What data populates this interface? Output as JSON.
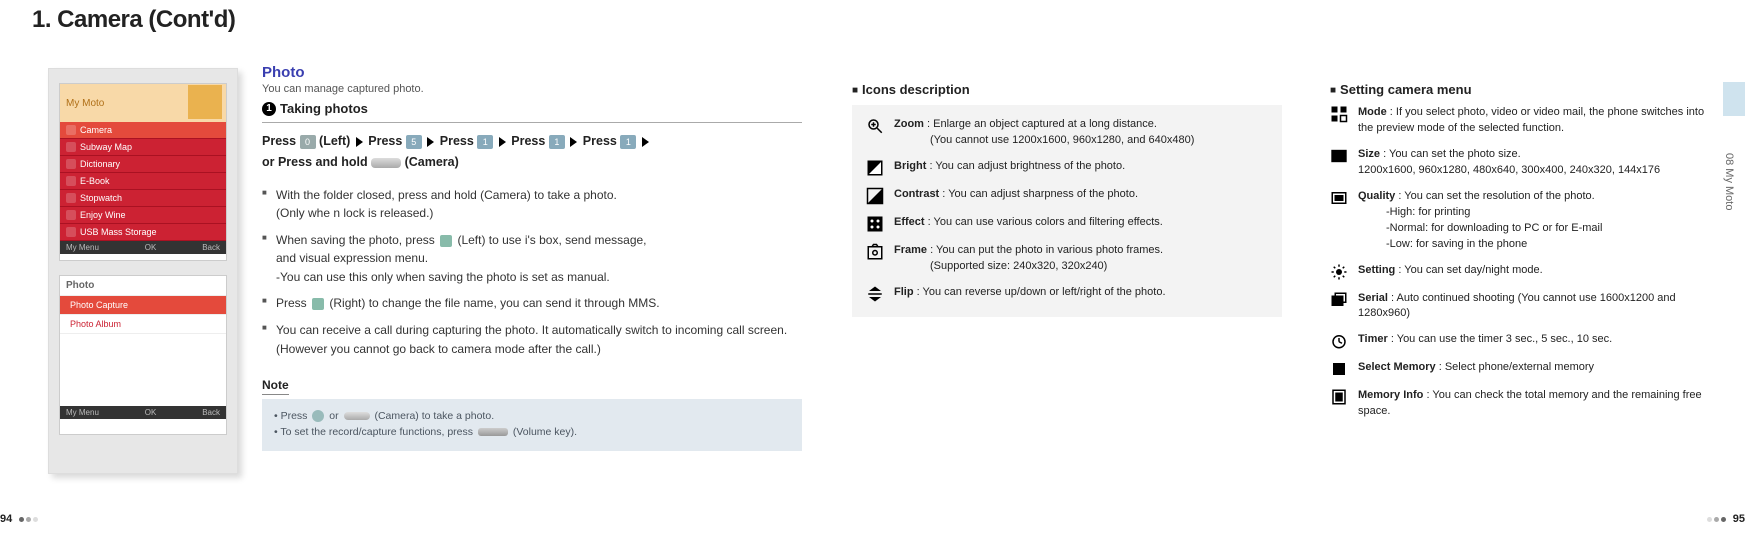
{
  "title": {
    "main": "1. Camera",
    "cont": "(Cont'd)"
  },
  "phone1": {
    "title": "My Moto",
    "items": [
      "Camera",
      "Subway Map",
      "Dictionary",
      "E-Book",
      "Stopwatch",
      "Enjoy Wine",
      "USB Mass Storage"
    ],
    "foot": {
      "l": "My Menu",
      "c": "OK",
      "r": "Back"
    }
  },
  "phone2": {
    "title": "Photo",
    "items": [
      "Photo Capture",
      "Photo Album"
    ],
    "foot": {
      "l": "My Menu",
      "c": "OK",
      "r": "Back"
    }
  },
  "photo": {
    "heading": "Photo",
    "sub": "You can manage captured photo.",
    "take_num": "1",
    "take_title": "Taking photos"
  },
  "press": {
    "a": "Press",
    "left": "(Left)",
    "b": "Press",
    "c": "Press",
    "d": "Press",
    "e": "Press",
    "keys": {
      "k0": "0",
      "k5": "5",
      "k1a": "1",
      "k1b": "1",
      "k1c": "1"
    },
    "line2a": "or Press and hold",
    "line2b": "(Camera)"
  },
  "bullets": {
    "b1a": "With the folder closed, press and hold",
    "b1b": "(Camera) to take a photo.",
    "b1c": "(Only whe n lock is released.)",
    "b2a": "When saving the photo, press",
    "b2b": "(Left) to use i's box, send message,",
    "b2c": "and visual expression menu.",
    "b2d": "-You can use this only when saving the photo is set as manual.",
    "b3a": "Press",
    "b3b": "(Right) to change the file name, you can send it through MMS.",
    "b4": "You can receive a call during capturing the photo. It automatically switch to incoming call screen. (However you cannot go back to camera mode after the call.)"
  },
  "note": {
    "label": "Note",
    "l1a": "Press",
    "l1b": "or",
    "l1c": "(Camera) to take a photo.",
    "l2a": "To set the record/capture functions, press",
    "l2b": "(Volume key)."
  },
  "icons": {
    "heading": "Icons description",
    "zoom": {
      "t": "Zoom",
      "d": ": Enlarge an object captured at a long distance.",
      "d2": "(You cannot use 1200x1600, 960x1280, and 640x480)"
    },
    "bright": {
      "t": "Bright",
      "d": ": You can adjust brightness of the photo."
    },
    "contrast": {
      "t": "Contrast",
      "d": ": You can adjust sharpness of the photo."
    },
    "effect": {
      "t": "Effect",
      "d": ": You can use various colors and filtering effects."
    },
    "frame": {
      "t": "Frame",
      "d": ": You can put the photo in various photo frames.",
      "d2": "(Supported size: 240x320, 320x240)"
    },
    "flip": {
      "t": "Flip",
      "d": ": You can reverse up/down or left/right of the photo."
    }
  },
  "settings": {
    "heading": "Setting camera menu",
    "mode": {
      "t": "Mode",
      "d": ": If you select photo, video or video mail, the phone switches into the preview mode of the selected function."
    },
    "size": {
      "t": "Size",
      "d": ": You can set the photo size.",
      "d2": "1200x1600, 960x1280, 480x640, 300x400, 240x320, 144x176"
    },
    "quality": {
      "t": "Quality",
      "d": ": You can set the resolution of the photo.",
      "q1": "-High: for printing",
      "q2": "-Normal: for downloading to PC or for E-mail",
      "q3": "-Low: for saving in the phone"
    },
    "setting": {
      "t": "Setting",
      "d": ": You can set day/night mode."
    },
    "serial": {
      "t": "Serial",
      "d": ": Auto continued shooting (You cannot use 1600x1200 and 1280x960)"
    },
    "timer": {
      "t": "Timer",
      "d": ": You can use the timer 3 sec., 5 sec., 10 sec."
    },
    "selmem": {
      "t": "Select Memory",
      "d": ": Select phone/external memory"
    },
    "meminfo": {
      "t": "Memory Info",
      "d": ": You can check the total memory and the remaining free space."
    }
  },
  "edge": {
    "label": "08 My Moto"
  },
  "pages": {
    "left": "94",
    "right": "95"
  }
}
